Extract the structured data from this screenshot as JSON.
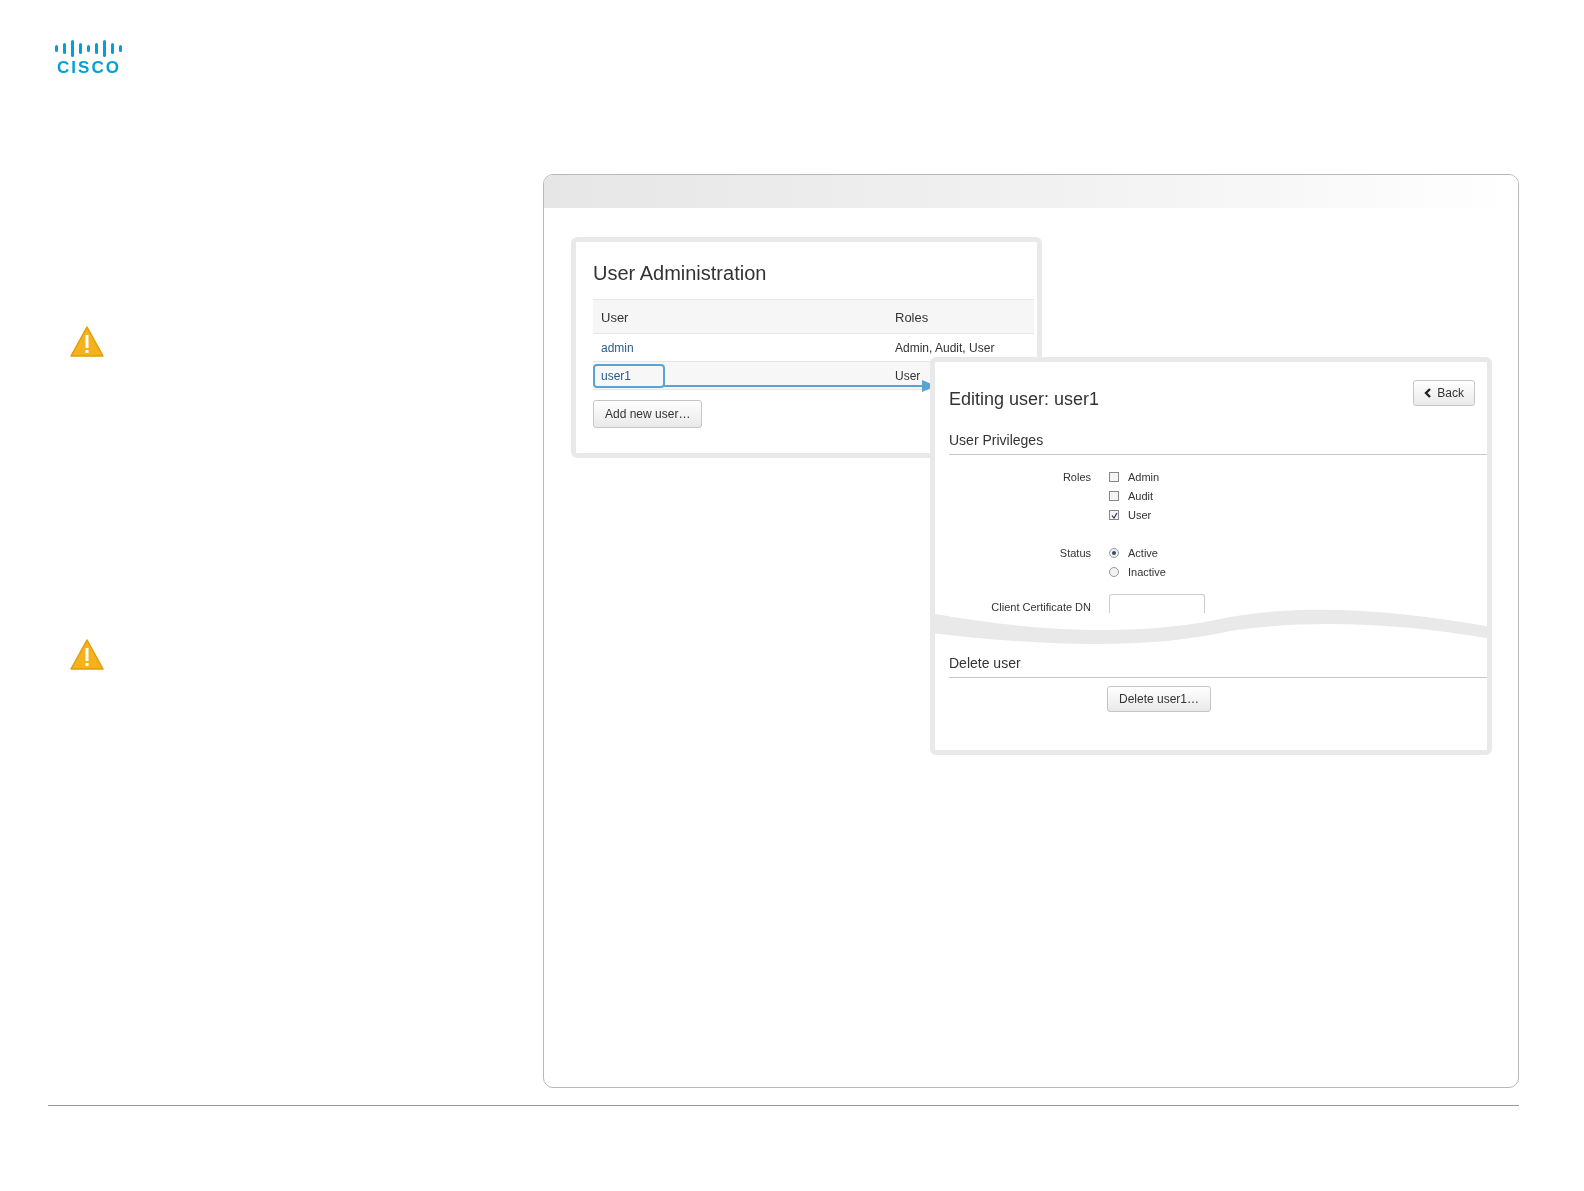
{
  "logo": {
    "text": "CISCO"
  },
  "notes": [
    {
      "kind": "warning"
    },
    {
      "kind": "warning"
    }
  ],
  "user_admin": {
    "title": "User Administration",
    "columns": [
      "User",
      "Roles"
    ],
    "rows": [
      {
        "user": "admin",
        "roles": "Admin, Audit, User",
        "selected": false
      },
      {
        "user": "user1",
        "roles": "User",
        "selected": true
      }
    ],
    "add_button": "Add new user…"
  },
  "edit_panel": {
    "title": "Editing user: user1",
    "back_button": "Back",
    "privileges_heading": "User Privileges",
    "fields": [
      {
        "kind": "checkbox_group",
        "label": "Roles",
        "options": [
          {
            "label": "Admin",
            "checked": false
          },
          {
            "label": "Audit",
            "checked": false
          },
          {
            "label": "User",
            "checked": true
          }
        ]
      },
      {
        "kind": "radio_group",
        "label": "Status",
        "options": [
          {
            "label": "Active",
            "selected": true
          },
          {
            "label": "Inactive",
            "selected": false
          }
        ]
      },
      {
        "kind": "text",
        "label": "Client Certificate DN"
      }
    ],
    "delete_heading": "Delete user",
    "delete_button": "Delete user1…"
  }
}
